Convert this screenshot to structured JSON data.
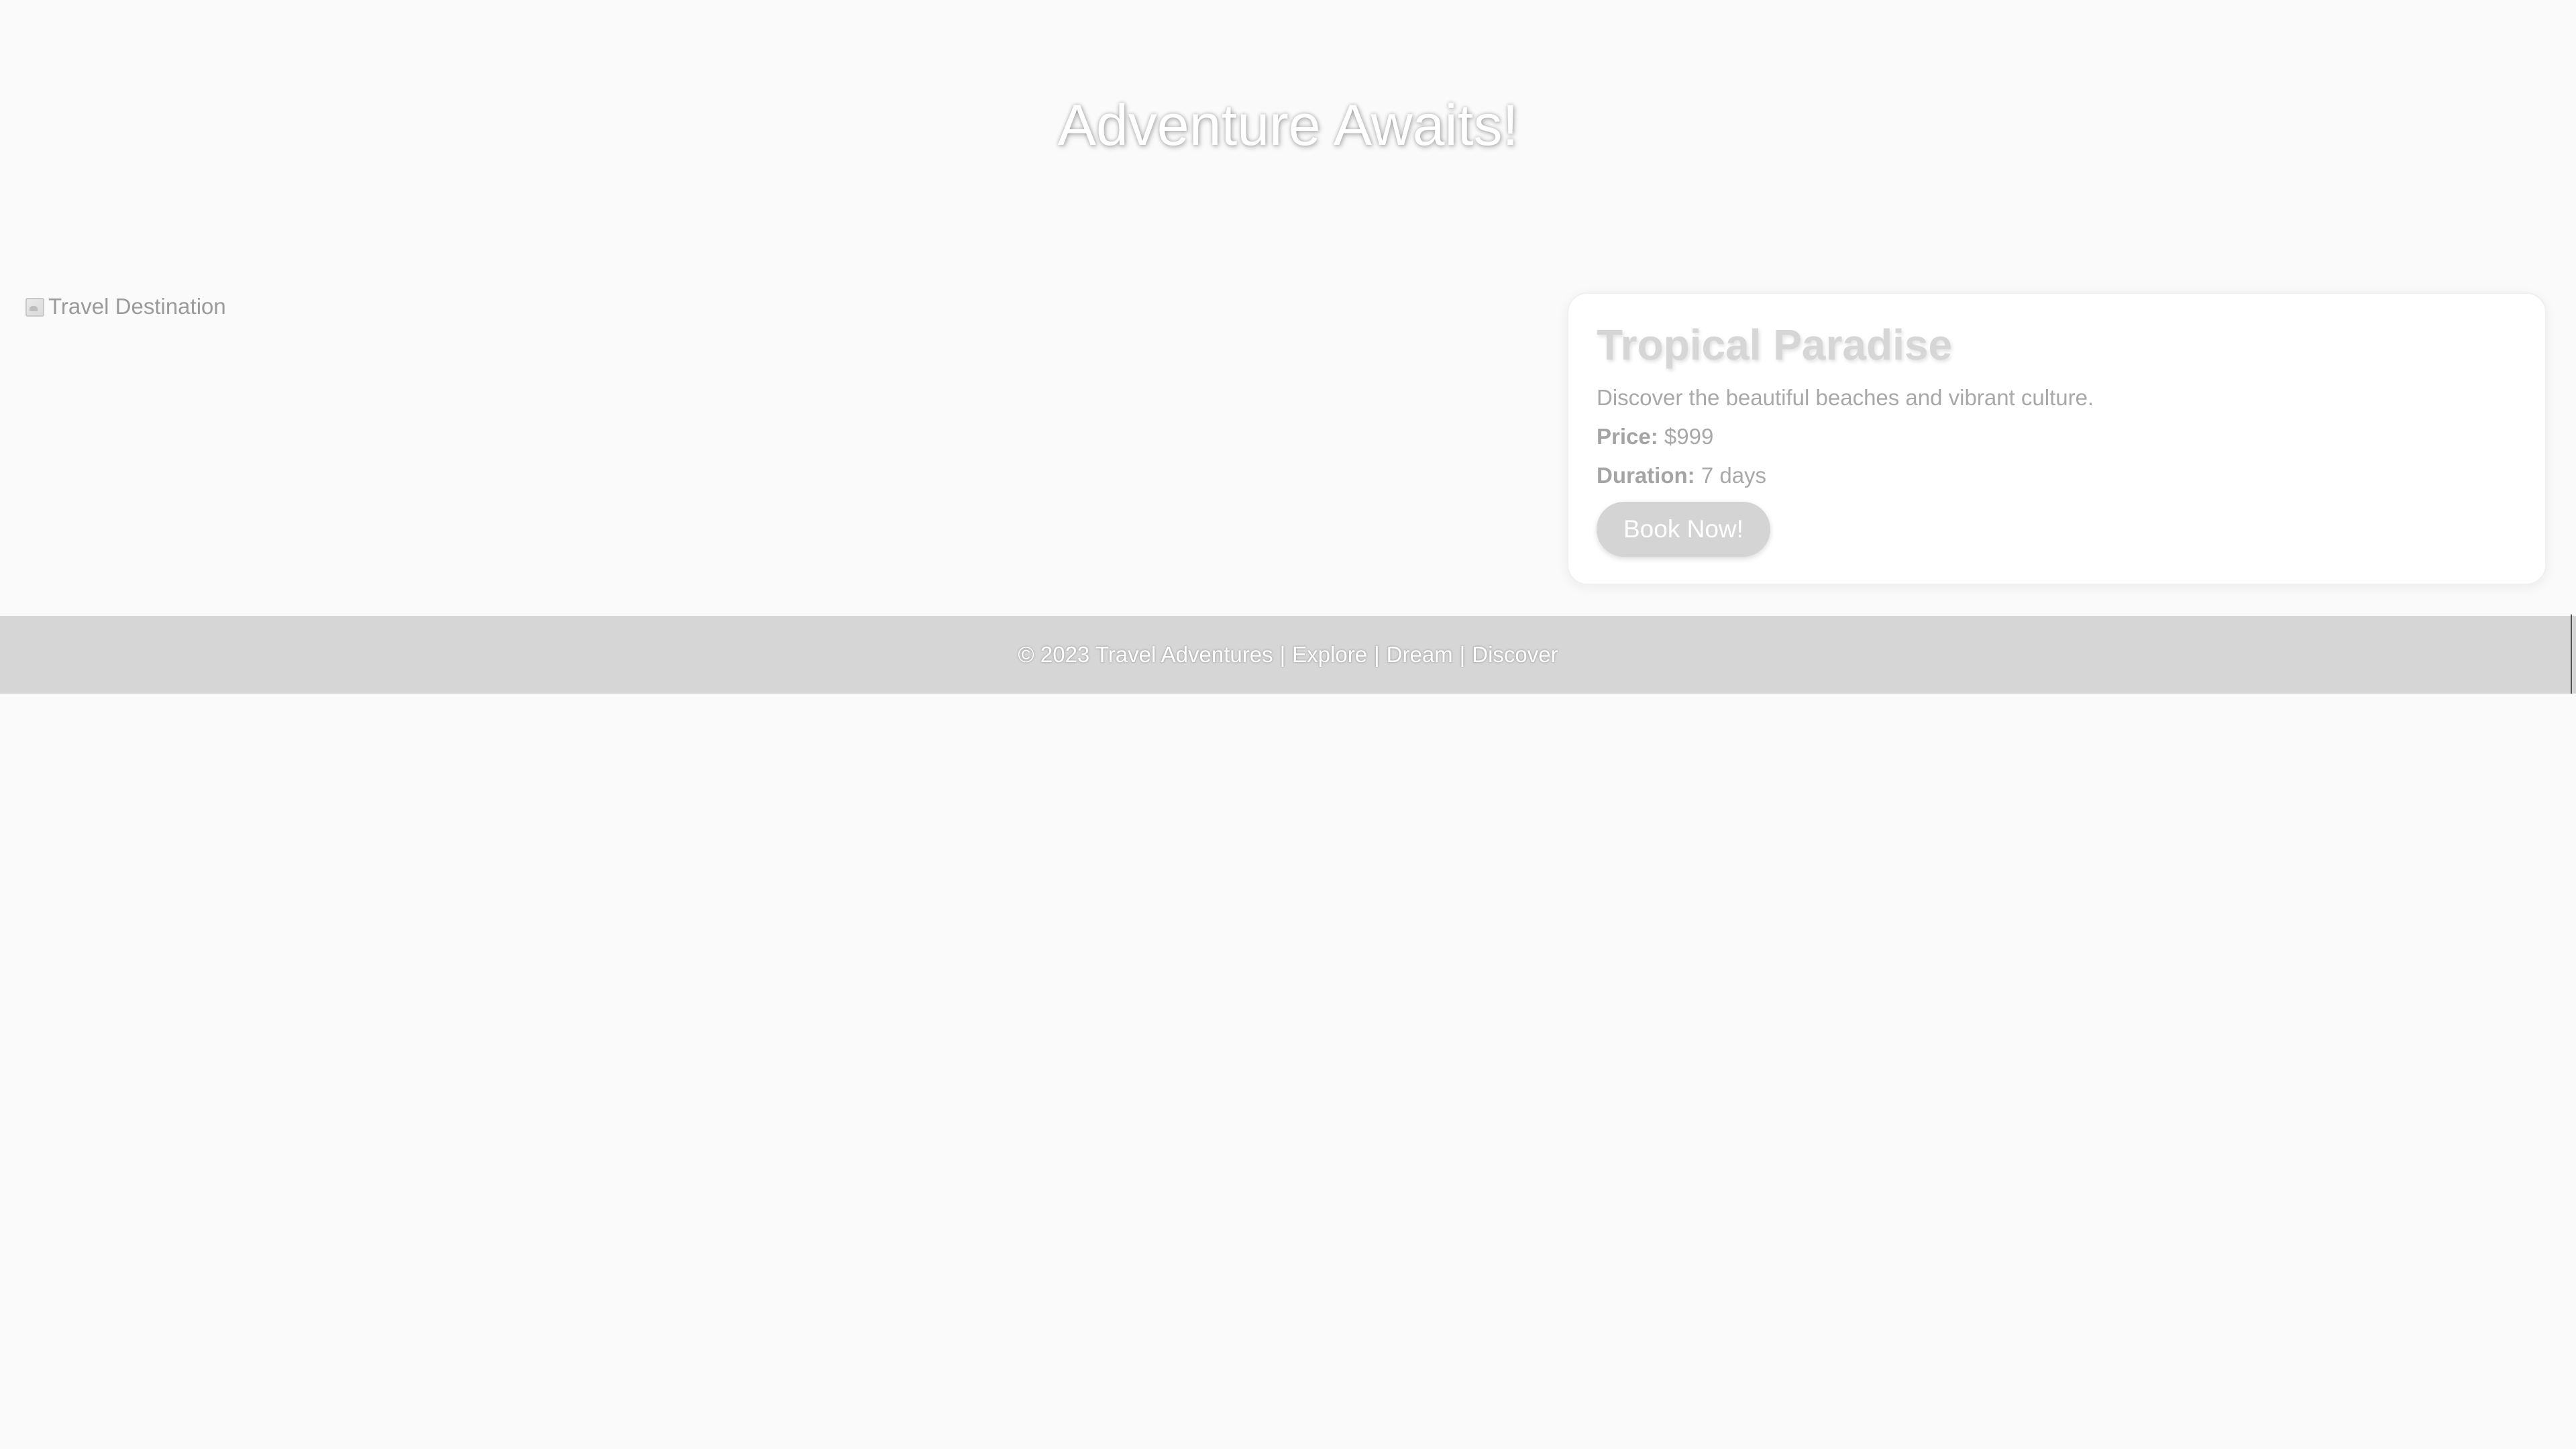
{
  "header": {
    "title": "Adventure Awaits!"
  },
  "destination": {
    "image_alt": "Travel Destination",
    "image_icon": "broken-image-icon"
  },
  "card": {
    "title": "Tropical Paradise",
    "description": "Discover the beautiful beaches and vibrant culture.",
    "price_label": "Price:",
    "price_value": "$999",
    "duration_label": "Duration:",
    "duration_value": "7 days",
    "button_label": "Book Now!"
  },
  "footer": {
    "copyright": "© 2023 Travel Adventures",
    "separator": "|",
    "links": [
      "Explore",
      "Dream",
      "Discover"
    ]
  },
  "colors": {
    "page_background": "#fafafa",
    "footer_background": "#d6d6d6",
    "button_background": "#d4d4d4",
    "card_background": "#ffffff"
  }
}
